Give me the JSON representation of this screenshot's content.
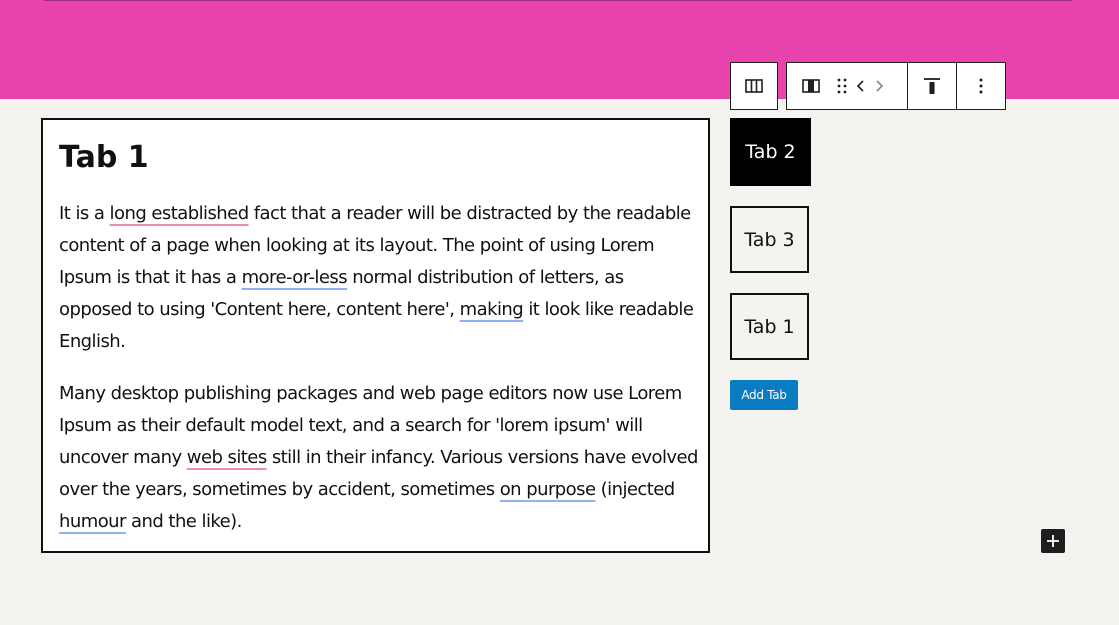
{
  "panel": {
    "heading": "Tab 1",
    "para1": [
      {
        "t": "It is a "
      },
      {
        "t": "long established",
        "mark": "red"
      },
      {
        "t": " fact that a reader will be distracted by the readable content of a page when looking at its layout. The point of using Lorem Ipsum is that it has a "
      },
      {
        "t": "more-or-less",
        "mark": "blue"
      },
      {
        "t": " normal distribution of letters, as opposed to using 'Content here, content here', "
      },
      {
        "t": "making",
        "mark": "blue"
      },
      {
        "t": " it look like readable English."
      }
    ],
    "para2": [
      {
        "t": "Many desktop publishing packages and web page editors now use Lorem Ipsum as their default model text, and a search for 'lorem ipsum' will uncover many "
      },
      {
        "t": "web sites",
        "mark": "red"
      },
      {
        "t": " still in their infancy. Various versions have evolved over the years, sometimes by accident, sometimes "
      },
      {
        "t": "on purpose",
        "mark": "blue"
      },
      {
        "t": " (injected "
      },
      {
        "t": "humour",
        "mark": "blue"
      },
      {
        "t": " and the like)."
      }
    ]
  },
  "tabs": {
    "active": "Tab 2",
    "second": "Tab 3",
    "third": "Tab 1"
  },
  "add_tab_label": "Add Tab",
  "toolbar": {
    "icons": [
      "columns-icon",
      "layout-icon",
      "drag-handle-icon",
      "chevron-left-icon",
      "chevron-right-icon",
      "align-top-icon",
      "more-options-icon"
    ]
  },
  "colors": {
    "banner": "#e843ad",
    "background": "#f4f3ef",
    "add_tab": "#0a7cc1"
  }
}
